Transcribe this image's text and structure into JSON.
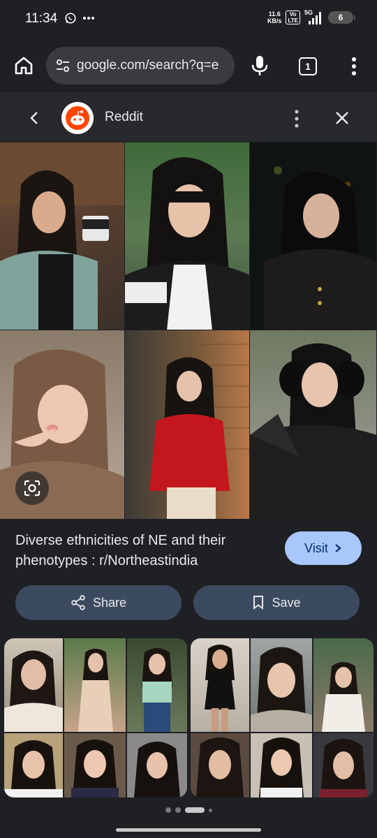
{
  "status_bar": {
    "time": "11:34",
    "net_speed_top": "11.6",
    "net_speed_bottom": "KB/s",
    "volte_top": "Vo",
    "volte_bottom": "LTE",
    "network": "5G",
    "battery": "6"
  },
  "toolbar": {
    "url": "google.com/search?q=e",
    "tab_count": "1"
  },
  "panel": {
    "source_name": "Reddit"
  },
  "result": {
    "title": "Diverse ethnicities of NE and their phenotypes : r/Northeastindia",
    "visit_label": "Visit",
    "share_label": "Share",
    "save_label": "Save"
  },
  "colors": {
    "background": "#1f2024",
    "visit_button": "#a8c7fa",
    "action_button": "#3c4a5f",
    "reddit_orange": "#ff4500"
  },
  "pagination": {
    "count": 5,
    "active_index": 2
  }
}
